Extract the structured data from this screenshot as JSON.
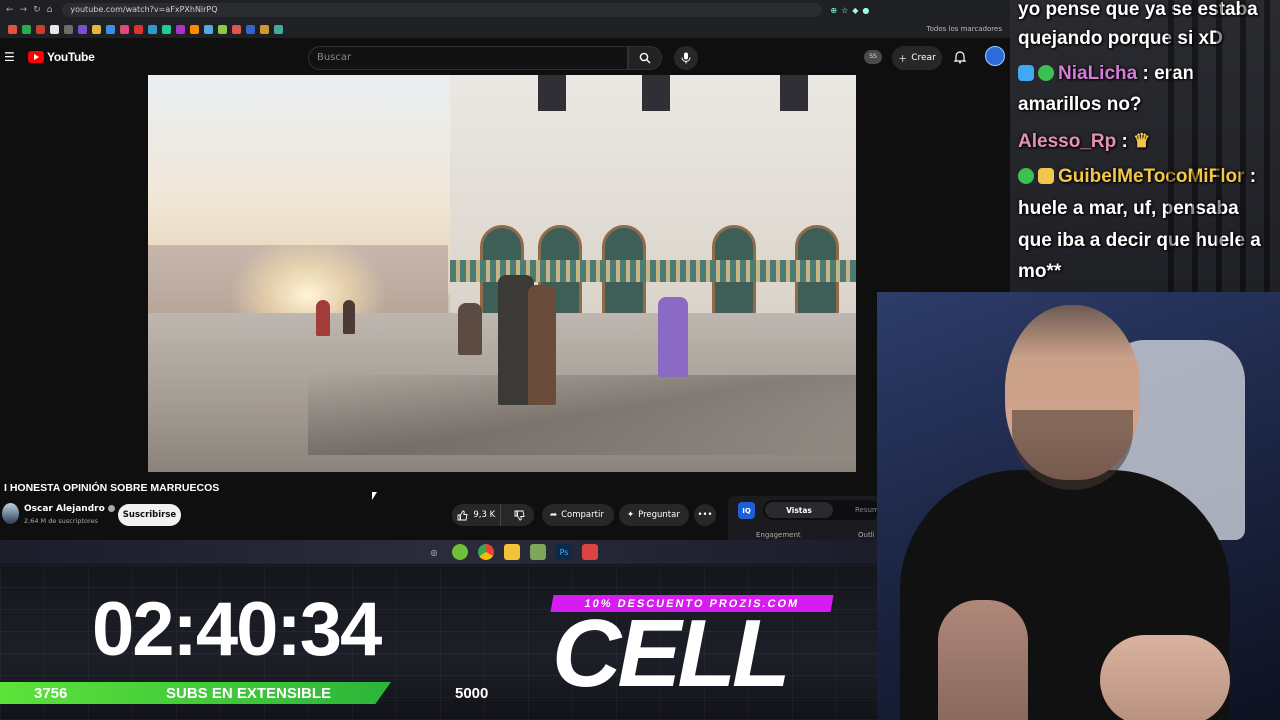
{
  "browser": {
    "url": "youtube.com/watch?v=aFxPXhNirPQ",
    "bookmarks_label": "Todos los marcadores"
  },
  "youtube": {
    "logo": "YouTube",
    "search_placeholder": "Buscar",
    "ss_badge": "SS",
    "create_label": "Crear",
    "video_title": "I HONESTA OPINIÓN SOBRE MARRUECOS",
    "channel_name": "Oscar Alejandro",
    "channel_subs": "2,64 M de suscriptores",
    "subscribe_label": "Suscribirse",
    "likes": "9,3 K",
    "share_label": "Compartir",
    "ask_label": "Preguntar",
    "panel": {
      "logo": "IQ",
      "tab_active": "Vistas",
      "tab_other": "Resum",
      "label_engagement": "Engagement",
      "label_outlier": "Outli"
    }
  },
  "overlay": {
    "timer": "02:40:34",
    "bar_current": "3756",
    "bar_label": "SUBS EN EXTENSIBLE",
    "bar_goal": "5000",
    "bar_progress": 0.751,
    "promo": "10% DESCUENTO PROZIS.COM",
    "brand": "CELL"
  },
  "chat": {
    "lines": [
      {
        "text": "yo pense que ya se estaba",
        "color": "#ffffff"
      },
      {
        "text": "quejando porque si xD",
        "color": "#ffffff"
      },
      {
        "user": "NiaLicha",
        "user_color": "#d77bd8",
        "text": " : eran"
      },
      {
        "text": "amarillos no?",
        "color": "#ffffff"
      },
      {
        "user": "Alesso_Rp",
        "user_color": "#e88fb4",
        "text": " : "
      },
      {
        "user": "GuibelMeTocoMiFlor",
        "user_color": "#f2c54d",
        "text": " :"
      },
      {
        "text": "huele a mar, uf, pensaba",
        "color": "#ffffff"
      },
      {
        "text": "que iba a decir que huele a",
        "color": "#ffffff"
      },
      {
        "text": "mo**",
        "color": "#ffffff"
      }
    ]
  },
  "colors": {
    "accent_green": "#5de23a",
    "promo_magenta": "#d61cf0",
    "youtube_red": "#ff0000"
  }
}
